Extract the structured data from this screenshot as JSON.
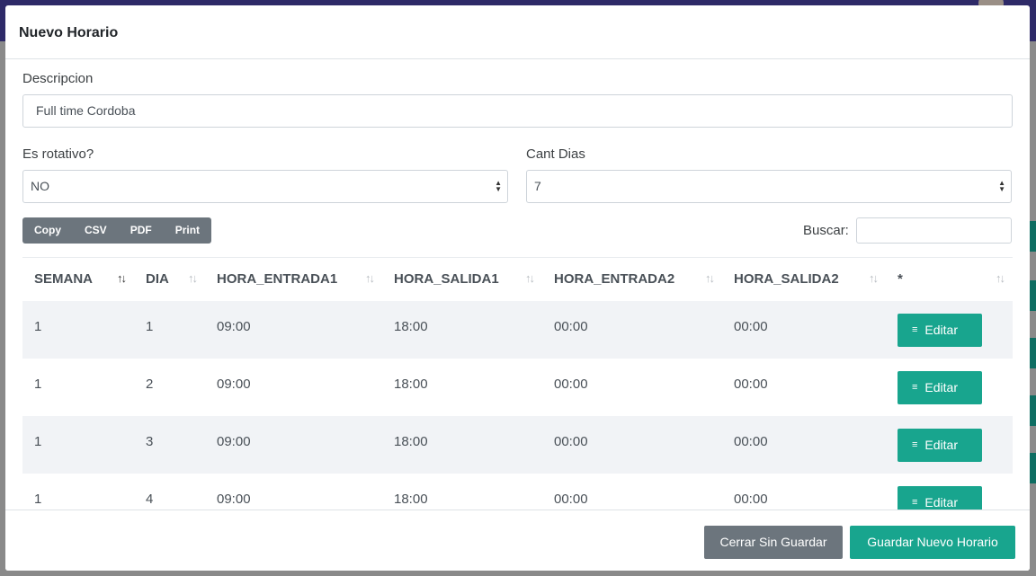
{
  "modal": {
    "title": "Nuevo Horario",
    "descripcion_label": "Descripcion",
    "descripcion_value": "Full time Cordoba",
    "rotativo_label": "Es rotativo?",
    "rotativo_value": "NO",
    "cantdias_label": "Cant Dias",
    "cantdias_value": "7"
  },
  "toolbar": {
    "buttons": [
      "Copy",
      "CSV",
      "PDF",
      "Print"
    ],
    "search_label": "Buscar:"
  },
  "table": {
    "headers": [
      "SEMANA",
      "DIA",
      "HORA_ENTRADA1",
      "HORA_SALIDA1",
      "HORA_ENTRADA2",
      "HORA_SALIDA2",
      "*"
    ],
    "rows": [
      [
        "1",
        "1",
        "09:00",
        "18:00",
        "00:00",
        "00:00"
      ],
      [
        "1",
        "2",
        "09:00",
        "18:00",
        "00:00",
        "00:00"
      ],
      [
        "1",
        "3",
        "09:00",
        "18:00",
        "00:00",
        "00:00"
      ],
      [
        "1",
        "4",
        "09:00",
        "18:00",
        "00:00",
        "00:00"
      ]
    ],
    "edit_label": "Editar"
  },
  "footer": {
    "close_label": "Cerrar Sin Guardar",
    "save_label": "Guardar Nuevo Horario"
  },
  "colors": {
    "primary_teal": "#18a58e",
    "secondary_gray": "#6c757d",
    "topbar": "#2e2a68"
  },
  "icons": {
    "sort": "sort-arrows-icon",
    "edit": "edit-lines-icon",
    "caret": "select-caret-icon"
  }
}
